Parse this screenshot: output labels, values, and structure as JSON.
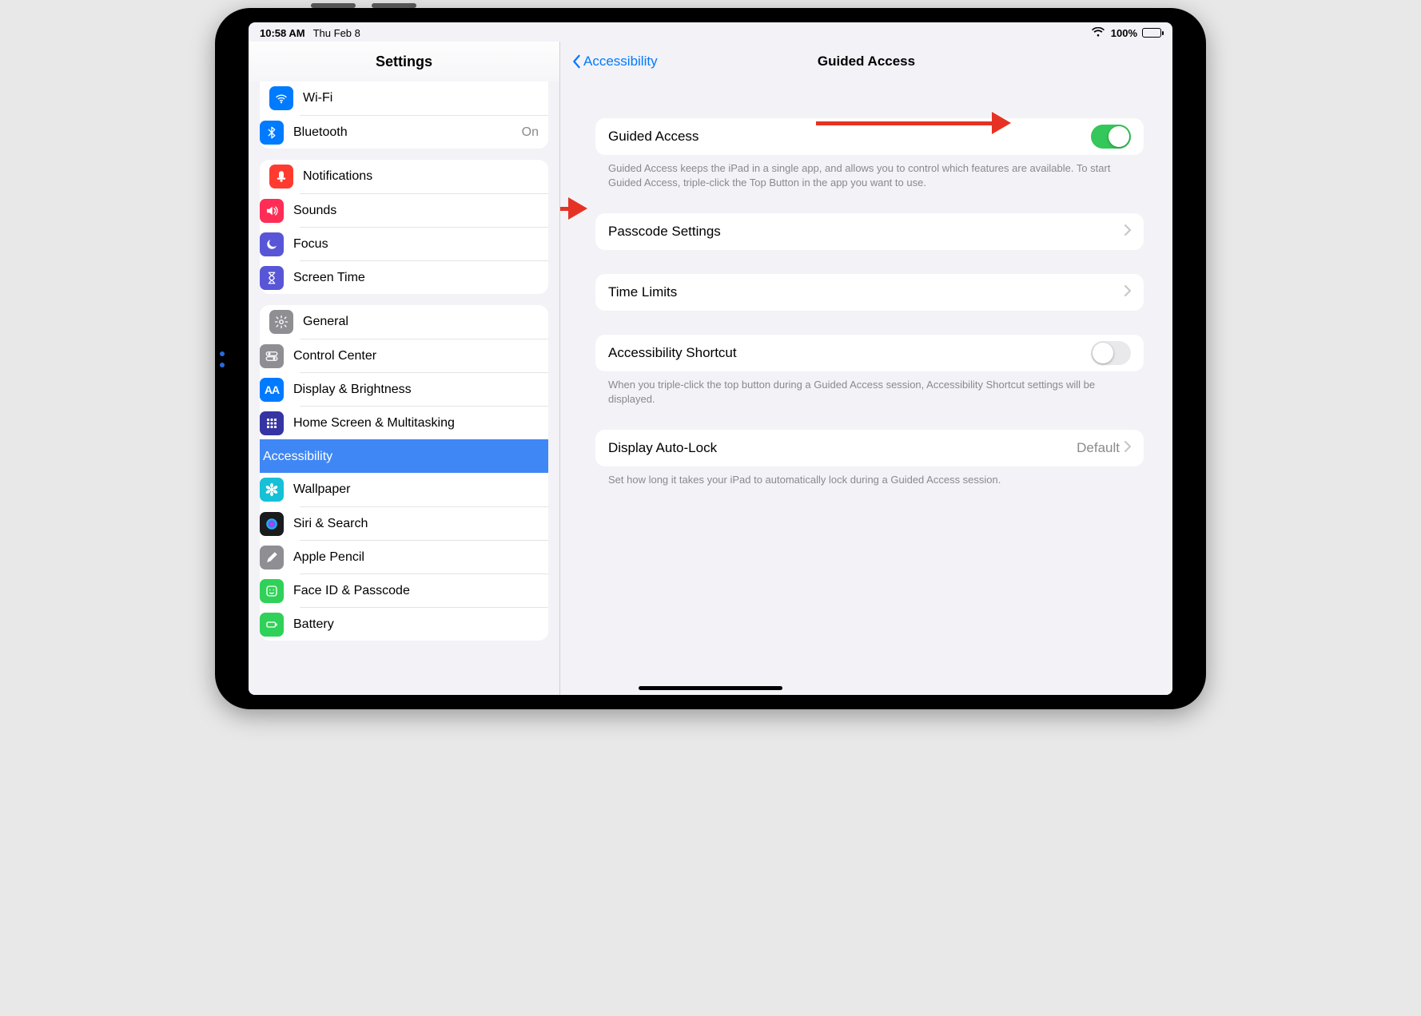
{
  "status": {
    "time": "10:58 AM",
    "date": "Thu Feb 8",
    "battery": "100%"
  },
  "sidebar": {
    "title": "Settings",
    "groups": [
      {
        "items": [
          {
            "id": "wifi",
            "label": "Wi-Fi",
            "icon_bg": "#007aff",
            "glyph": "wifi"
          },
          {
            "id": "bluetooth",
            "label": "Bluetooth",
            "value": "On",
            "icon_bg": "#007aff",
            "glyph": "bluetooth"
          }
        ]
      },
      {
        "items": [
          {
            "id": "notifications",
            "label": "Notifications",
            "icon_bg": "#ff3b30",
            "glyph": "bell"
          },
          {
            "id": "sounds",
            "label": "Sounds",
            "icon_bg": "#ff2d55",
            "glyph": "speaker"
          },
          {
            "id": "focus",
            "label": "Focus",
            "icon_bg": "#5856d6",
            "glyph": "moon"
          },
          {
            "id": "screentime",
            "label": "Screen Time",
            "icon_bg": "#5856d6",
            "glyph": "hourglass"
          }
        ]
      },
      {
        "items": [
          {
            "id": "general",
            "label": "General",
            "icon_bg": "#8e8e93",
            "glyph": "gear"
          },
          {
            "id": "controlcenter",
            "label": "Control Center",
            "icon_bg": "#8e8e93",
            "glyph": "toggles"
          },
          {
            "id": "display",
            "label": "Display & Brightness",
            "icon_bg": "#007aff",
            "glyph": "AA"
          },
          {
            "id": "homescreen",
            "label": "Home Screen & Multitasking",
            "icon_bg": "#3634a3",
            "glyph": "grid"
          },
          {
            "id": "accessibility",
            "label": "Accessibility",
            "icon_bg": "#007aff",
            "glyph": "person",
            "selected": true
          },
          {
            "id": "wallpaper",
            "label": "Wallpaper",
            "icon_bg": "#16c0d6",
            "glyph": "flower"
          },
          {
            "id": "siri",
            "label": "Siri & Search",
            "icon_bg": "#1b1b1d",
            "glyph": "siri"
          },
          {
            "id": "pencil",
            "label": "Apple Pencil",
            "icon_bg": "#8e8e93",
            "glyph": "pencil"
          },
          {
            "id": "faceid",
            "label": "Face ID & Passcode",
            "icon_bg": "#30d158",
            "glyph": "face"
          },
          {
            "id": "battery",
            "label": "Battery",
            "icon_bg": "#30d158",
            "glyph": "battery"
          }
        ]
      }
    ]
  },
  "detail": {
    "back_label": "Accessibility",
    "title": "Guided Access",
    "sections": [
      {
        "rows": [
          {
            "id": "guided-access-toggle",
            "label": "Guided Access",
            "toggle": true
          }
        ],
        "footer": "Guided Access keeps the iPad in a single app, and allows you to control which features are available. To start Guided Access, triple-click the Top Button in the app you want to use."
      },
      {
        "rows": [
          {
            "id": "passcode-settings",
            "label": "Passcode Settings",
            "chevron": true
          }
        ]
      },
      {
        "rows": [
          {
            "id": "time-limits",
            "label": "Time Limits",
            "chevron": true
          }
        ]
      },
      {
        "rows": [
          {
            "id": "accessibility-shortcut",
            "label": "Accessibility Shortcut",
            "toggle": false
          }
        ],
        "footer": "When you triple-click the top button during a Guided Access session, Accessibility Shortcut settings will be displayed."
      },
      {
        "rows": [
          {
            "id": "display-autolock",
            "label": "Display Auto-Lock",
            "value": "Default",
            "chevron": true
          }
        ],
        "footer": "Set how long it takes your iPad to automatically lock during a Guided Access session."
      }
    ]
  }
}
